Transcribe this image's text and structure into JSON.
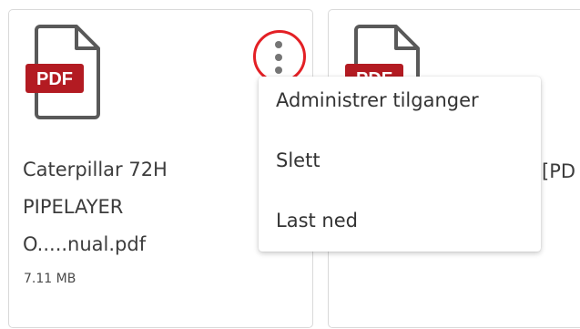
{
  "files": [
    {
      "icon": "pdf-file-icon",
      "badge": "PDF",
      "name_lines": [
        "Caterpillar 72H",
        "PIPELAYER",
        "O.....nual.pdf"
      ],
      "size": "7.11 MB"
    },
    {
      "icon": "pdf-file-icon",
      "badge": "PDF",
      "name_partial": "[PD"
    }
  ],
  "menu": {
    "items": [
      "Administrer tilganger",
      "Slett",
      "Last ned"
    ]
  },
  "colors": {
    "pdf_badge": "#b31b22",
    "icon_outline": "#595959",
    "highlight_ring": "#e32025"
  }
}
